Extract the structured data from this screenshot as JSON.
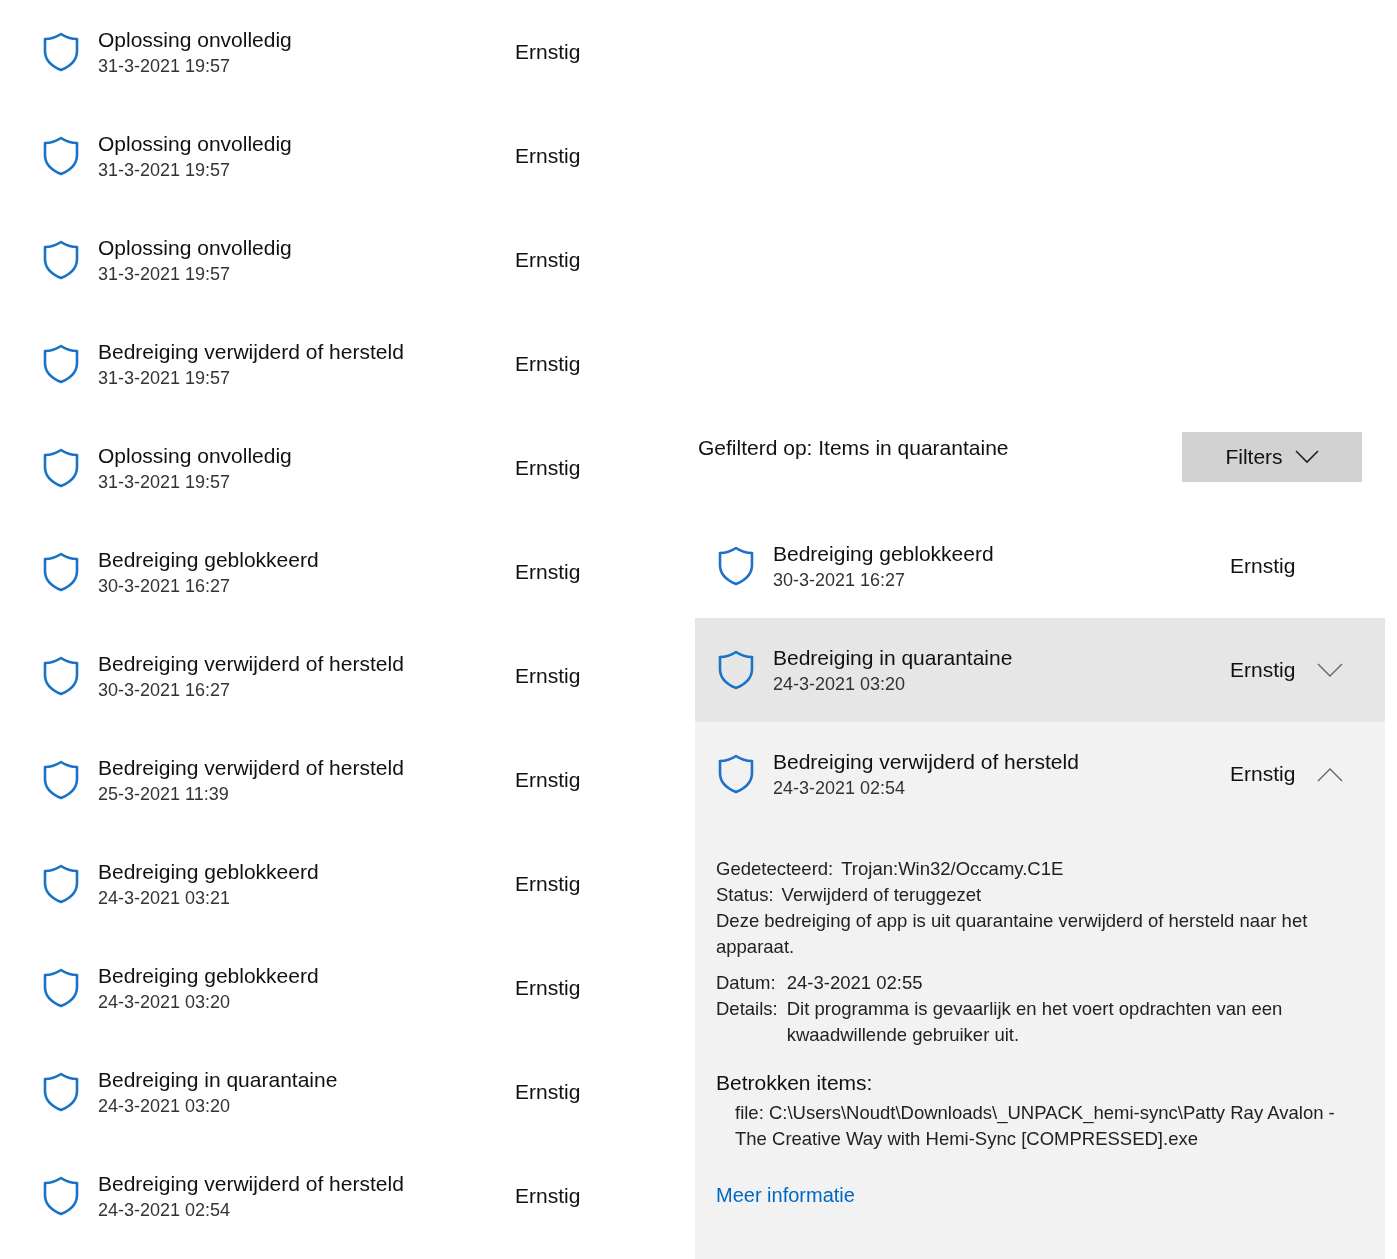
{
  "history": [
    {
      "title": "Oplossing onvolledig",
      "time": "31-3-2021 19:57",
      "severity": "Ernstig"
    },
    {
      "title": "Oplossing onvolledig",
      "time": "31-3-2021 19:57",
      "severity": "Ernstig"
    },
    {
      "title": "Oplossing onvolledig",
      "time": "31-3-2021 19:57",
      "severity": "Ernstig"
    },
    {
      "title": "Bedreiging verwijderd of hersteld",
      "time": "31-3-2021 19:57",
      "severity": "Ernstig"
    },
    {
      "title": "Oplossing onvolledig",
      "time": "31-3-2021 19:57",
      "severity": "Ernstig"
    },
    {
      "title": "Bedreiging geblokkeerd",
      "time": "30-3-2021 16:27",
      "severity": "Ernstig"
    },
    {
      "title": "Bedreiging verwijderd of hersteld",
      "time": "30-3-2021 16:27",
      "severity": "Ernstig"
    },
    {
      "title": "Bedreiging verwijderd of hersteld",
      "time": "25-3-2021 11:39",
      "severity": "Ernstig"
    },
    {
      "title": "Bedreiging geblokkeerd",
      "time": "24-3-2021 03:21",
      "severity": "Ernstig"
    },
    {
      "title": "Bedreiging geblokkeerd",
      "time": "24-3-2021 03:20",
      "severity": "Ernstig"
    },
    {
      "title": "Bedreiging in quarantaine",
      "time": "24-3-2021 03:20",
      "severity": "Ernstig"
    },
    {
      "title": "Bedreiging verwijderd of hersteld",
      "time": "24-3-2021 02:54",
      "severity": "Ernstig"
    }
  ],
  "filter": {
    "label": "Gefilterd op: Items in quarantaine",
    "button": "Filters"
  },
  "filtered": [
    {
      "title": "Bedreiging geblokkeerd",
      "time": "30-3-2021 16:27",
      "severity": "Ernstig",
      "selected": false,
      "expanded": false
    },
    {
      "title": "Bedreiging in quarantaine",
      "time": "24-3-2021 03:20",
      "severity": "Ernstig",
      "selected": true,
      "expanded": false
    },
    {
      "title": "Bedreiging verwijderd of hersteld",
      "time": "24-3-2021 02:54",
      "severity": "Ernstig",
      "selected": false,
      "expanded": true
    }
  ],
  "details": {
    "fields_top": [
      {
        "label": "Gedetecteerd:",
        "value": "Trojan:Win32/Occamy.C1E"
      },
      {
        "label": "Status:",
        "value": "Verwijderd of teruggezet"
      }
    ],
    "description": "Deze bedreiging of app is uit quarantaine verwijderd of hersteld naar het apparaat.",
    "fields": [
      {
        "label": "Datum:",
        "value": "24-3-2021 02:55"
      },
      {
        "label": "Details:",
        "value": "Dit programma is gevaarlijk en het voert opdrachten van een kwaadwillende gebruiker uit."
      }
    ],
    "items_heading": "Betrokken items:",
    "items": [
      "file: C:\\Users\\Noudt\\Downloads\\_UNPACK_hemi-sync\\Patty Ray Avalon - The Creative Way with Hemi-Sync [COMPRESSED].exe"
    ],
    "link": "Meer informatie"
  }
}
